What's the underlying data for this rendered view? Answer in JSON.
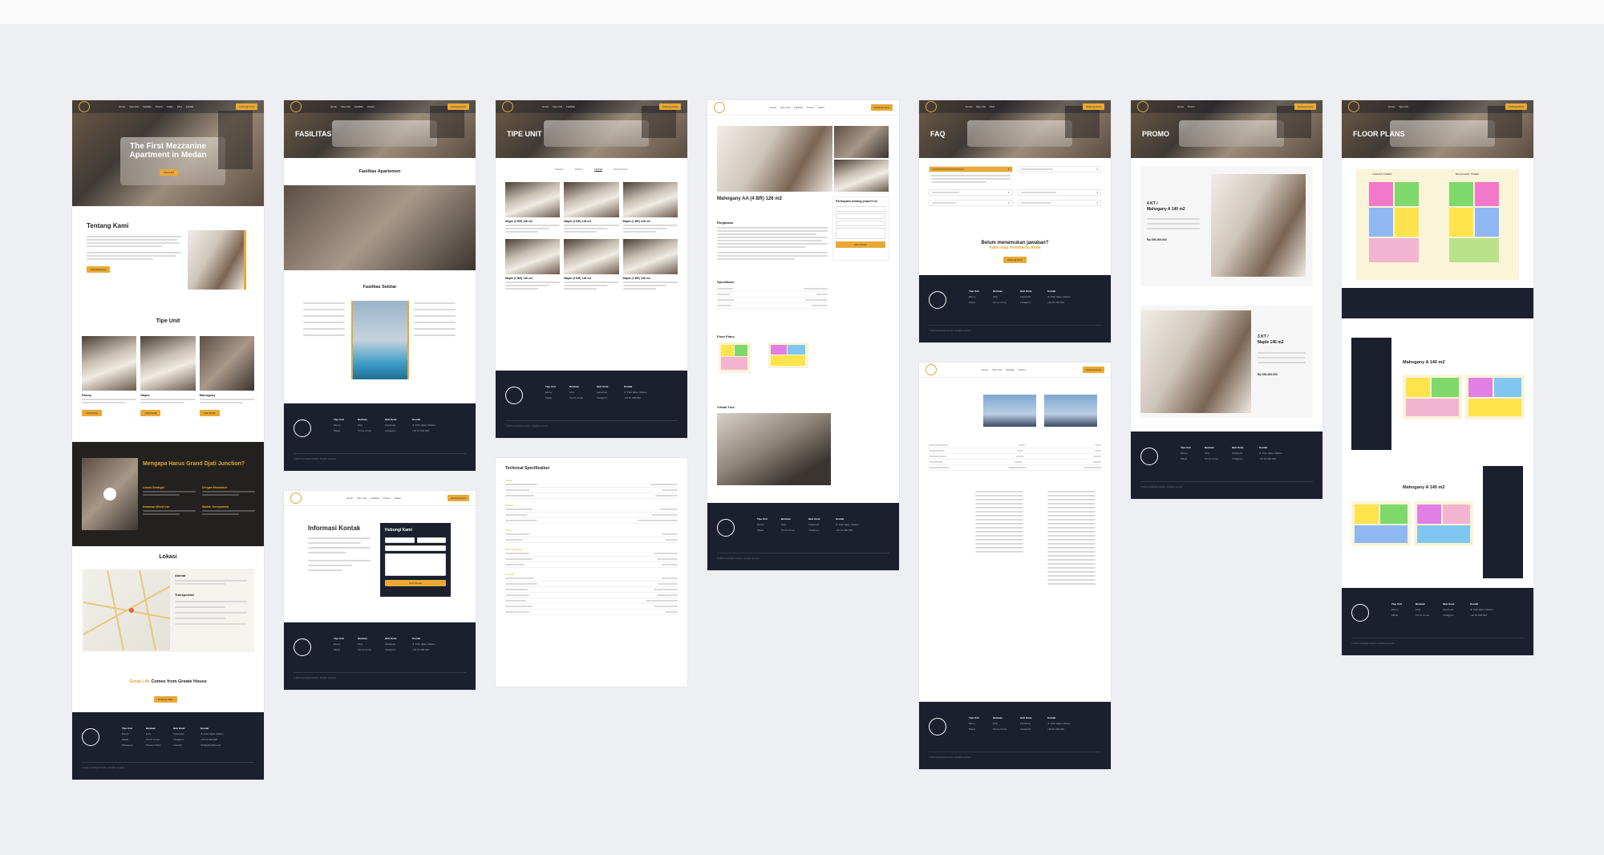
{
  "nav": {
    "links": [
      "Home",
      "Tipe Unit",
      "Fasilitas",
      "Promo",
      "Galeri",
      "FAQ",
      "Kontak"
    ],
    "cta": "Hubungi Kami"
  },
  "home": {
    "hero_title": "The First Mezzanine Apartment in Medan",
    "hero_btn": "Lihat Unit",
    "about_title": "Tentang Kami",
    "about_btn": "Selengkapnya",
    "tipe_title": "Tipe Unit",
    "units": [
      {
        "name": "Ebony",
        "btn": "Lihat Detail"
      },
      {
        "name": "Maple",
        "btn": "Lihat Detail"
      },
      {
        "name": "Mahogany",
        "btn": "Lihat Detail"
      }
    ],
    "why_title": "Mengapa Harus Grand Djati Junction?",
    "why_items": [
      "Lokasi Strategis",
      "Dengan Mezzanine",
      "Kawasan Mixed Use",
      "Mudah Transportasi"
    ],
    "lokasi_title": "Lokasi",
    "alamat": "Alamat",
    "transportasi": "Transportasi",
    "tagline_gold": "Great Life",
    "tagline_rest": "Comes from Greate House",
    "tagline_btn": "Hubungi Kami"
  },
  "fasilitas": {
    "hero_title": "FASILITAS",
    "apartemen_title": "Fasilitas Apartemen",
    "sekitar_title": "Fasilitas Sekitar"
  },
  "kontak": {
    "info_title": "Informasi Kontak",
    "form_title": "Hubungi Kami",
    "form_btn": "Kirim Pesan"
  },
  "tipe": {
    "hero_title": "TIPE UNIT",
    "tabs": [
      "SEMUA",
      "EBONY",
      "MAPLE",
      "MAHOGANY"
    ],
    "cards": [
      "Maple (2 BR) 146 m2",
      "Maple (3 BR) 146 m2",
      "Maple (1 BR) 146 m2",
      "Maple (2 BR) 146 m2",
      "Maple (3 BR) 146 m2",
      "Maple (1 BR) 146 m2"
    ],
    "spec_title": "Technical Specification",
    "spec_groups": [
      "Lantai",
      "Dinding",
      "Plafon",
      "Pintu & Jendela",
      "Lain-lain"
    ]
  },
  "detail": {
    "title": "Mahogany AA (4 BR) 126 m2",
    "ringkasan": "Ringkasan",
    "spesifikasi": "Spesifikasi",
    "floor_plans": "Floor Plans",
    "virtual_tour": "Virtual Tour",
    "side_title": "Pertanyaan tentang properti ini",
    "side_btn": "Kirim Pesan"
  },
  "faq": {
    "hero_title": "FAQ",
    "cta_title": "Belum menemukan jawaban?",
    "cta_sub": "Kami siap membantu Anda",
    "cta_btn": "Hubungi Kami"
  },
  "promo": {
    "hero_title": "PROMO",
    "card1_sub": "4 KT /",
    "card1_title": "Mahogany A 140 m2",
    "card1_price": "Rp 000.000.000",
    "card2_sub": "3 KT /",
    "card2_title": "Maple 146 m2",
    "card2_price": "Rp 000.000.000"
  },
  "floor": {
    "hero_title": "FLOOR PLANS",
    "tower_a": "GARUDA TOWER",
    "tower_b": "BALTHAZAR TOWER",
    "plan1_title": "Mahogany A 140 m2",
    "plan2_title": "Mahogany A 140 m2"
  },
  "footer": {
    "cols": [
      {
        "head": "Tipe Unit",
        "items": [
          "Ebony",
          "Maple",
          "Mahogany"
        ]
      },
      {
        "head": "Bantuan",
        "items": [
          "FAQ",
          "Terms of use",
          "Privacy Policy"
        ]
      },
      {
        "head": "Ikuti Kami",
        "items": [
          "Facebook",
          "Instagram",
          "Youtube"
        ]
      },
      {
        "head": "Kontak",
        "items": [
          "Jl. Putri Hijau, Medan",
          "+62 61 000 000",
          "info@grandjati.com"
        ]
      }
    ],
    "copyright": "© 2023 Grand Djati Junction. All rights reserved."
  },
  "colors": {
    "accent": "#e9a934",
    "footer": "#1b1f2e",
    "canvas": "#eeeff3"
  }
}
